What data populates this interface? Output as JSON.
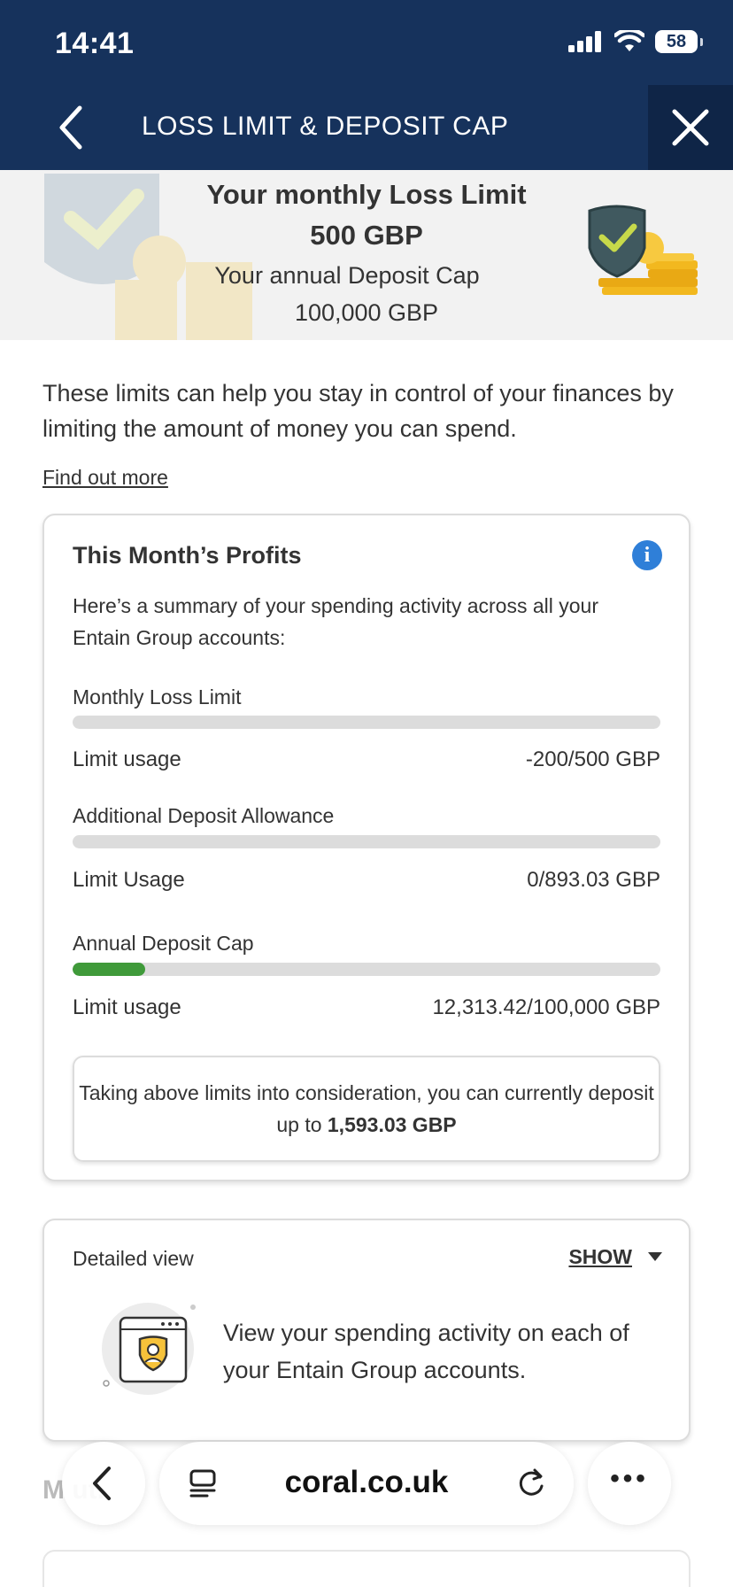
{
  "status_bar": {
    "time": "14:41",
    "battery": "58"
  },
  "nav": {
    "title": "LOSS LIMIT & DEPOSIT CAP"
  },
  "hero": {
    "line1": "Your monthly Loss Limit",
    "line2": "500 GBP",
    "line3": "Your annual Deposit Cap",
    "line4": "100,000 GBP"
  },
  "intro": {
    "text": "These limits can help you stay in control of your finances by limiting the amount of money you can spend.",
    "link": "Find out more"
  },
  "profits": {
    "title": "This Month’s Profits",
    "subtitle": "Here’s a summary of your spending activity across all your Entain Group accounts:",
    "limits": [
      {
        "label": "Monthly Loss Limit",
        "usage_label": "Limit usage",
        "usage_value": "-200/500 GBP",
        "fill_fraction": 0
      },
      {
        "label": "Additional Deposit Allowance",
        "usage_label": "Limit Usage",
        "usage_value": "0/893.03 GBP",
        "fill_fraction": 0
      },
      {
        "label": "Annual Deposit Cap",
        "usage_label": "Limit usage",
        "usage_value": "12,313.42/100,000 GBP",
        "fill_fraction": 0.123
      }
    ],
    "deposit_note_prefix": "Taking above limits into consideration, you can currently deposit up to",
    "deposit_note_amount": "1,593.03 GBP"
  },
  "detailed_view": {
    "label": "Detailed view",
    "toggle": "SHOW",
    "text": "View your spending activity on each of your Entain Group accounts."
  },
  "section_heading": "M    ut.",
  "browser": {
    "url": "coral.co.uk"
  },
  "colors": {
    "header": "#16325c",
    "progress": "#3f9a3a",
    "info": "#2f7fd8"
  }
}
